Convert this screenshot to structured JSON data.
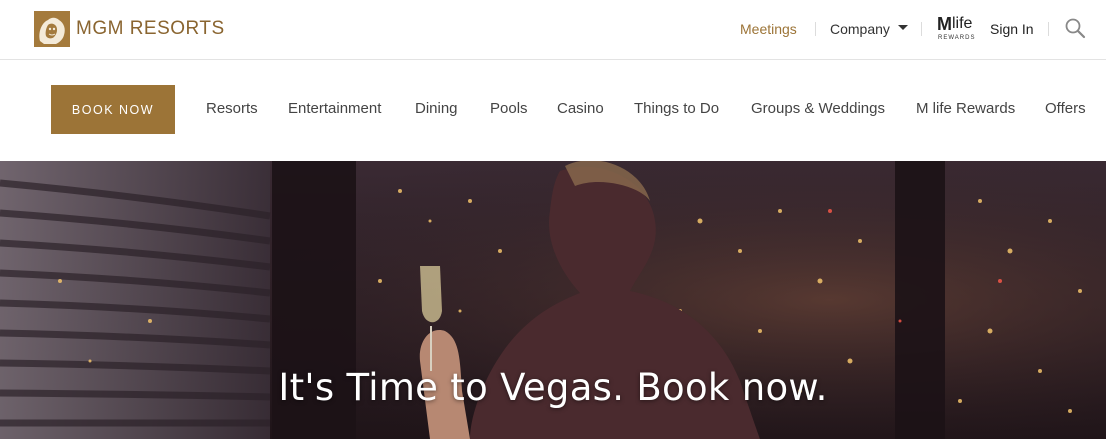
{
  "brand": {
    "name": "MGM RESORTS",
    "logo_icon": "lion-head-icon"
  },
  "utility_nav": {
    "meetings": "Meetings",
    "company": "Company",
    "mlife_logo_main": "M",
    "mlife_logo_life": "life",
    "mlife_logo_sub": "REWARDS",
    "sign_in": "Sign In",
    "search_icon": "search-icon"
  },
  "main_nav": {
    "book_now": "BOOK NOW",
    "items": [
      "Resorts",
      "Entertainment",
      "Dining",
      "Pools",
      "Casino",
      "Things to Do",
      "Groups & Weddings",
      "M life Rewards",
      "Offers"
    ]
  },
  "hero": {
    "title": "It's Time to Vegas. Book now."
  },
  "colors": {
    "accent_gold": "#9c7437",
    "text_dark": "#333333",
    "hero_overlay": "#2a1c22"
  }
}
